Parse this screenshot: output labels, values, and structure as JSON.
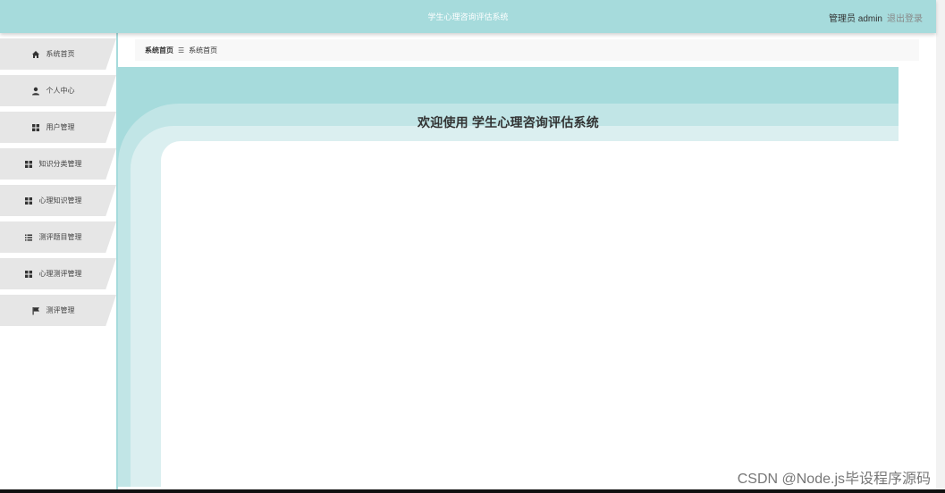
{
  "header": {
    "title": "学生心理咨询评估系统",
    "user_label": "管理员 admin",
    "logout_label": "退出登录"
  },
  "sidebar": {
    "items": [
      {
        "label": "系统首页",
        "icon": "home-icon"
      },
      {
        "label": "个人中心",
        "icon": "user-icon"
      },
      {
        "label": "用户管理",
        "icon": "grid-icon"
      },
      {
        "label": "知识分类管理",
        "icon": "grid-icon"
      },
      {
        "label": "心理知识管理",
        "icon": "grid-icon"
      },
      {
        "label": "测评题目管理",
        "icon": "list-icon"
      },
      {
        "label": "心理测评管理",
        "icon": "grid-icon"
      },
      {
        "label": "测评管理",
        "icon": "flag-icon"
      }
    ]
  },
  "breadcrumb": {
    "root": "系统首页",
    "separator": "☰",
    "current": "系统首页"
  },
  "main": {
    "welcome": "欢迎使用 学生心理咨询评估系统"
  },
  "watermark": "CSDN @Node.js毕设程序源码",
  "colors": {
    "accent": "#a6dbdc",
    "accent_light": "#c1e5e6",
    "accent_lighter": "#dbeff0",
    "menu_bg": "#e6e6e6"
  }
}
